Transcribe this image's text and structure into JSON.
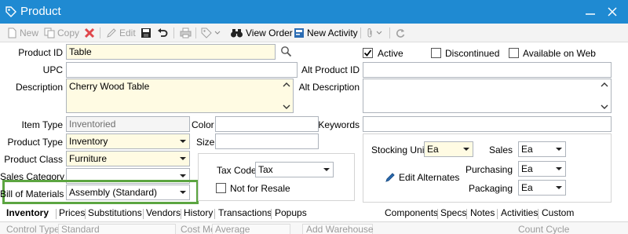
{
  "window": {
    "title": "Product"
  },
  "toolbar": {
    "new": "New",
    "copy": "Copy",
    "edit": "Edit",
    "view_order": "View Order",
    "new_activity": "New Activity"
  },
  "form": {
    "product_id": {
      "label": "Product ID",
      "value": "Table"
    },
    "upc": {
      "label": "UPC",
      "value": ""
    },
    "description": {
      "label": "Description",
      "value": "Cherry Wood Table"
    },
    "active": {
      "label": "Active",
      "checked": true
    },
    "discontinued": {
      "label": "Discontinued",
      "checked": false
    },
    "available_on_web": {
      "label": "Available on Web",
      "checked": false
    },
    "alt_product_id": {
      "label": "Alt Product ID",
      "value": ""
    },
    "alt_description": {
      "label": "Alt Description",
      "value": ""
    },
    "item_type": {
      "label": "Item Type",
      "value": "Inventoried"
    },
    "color": {
      "label": "Color",
      "value": ""
    },
    "keywords": {
      "label": "Keywords",
      "value": ""
    },
    "product_type": {
      "label": "Product Type",
      "value": "Inventory"
    },
    "size": {
      "label": "Size",
      "value": ""
    },
    "product_class": {
      "label": "Product Class",
      "value": "Furniture"
    },
    "sales_category": {
      "label": "Sales Category",
      "value": ""
    },
    "bill_of_materials": {
      "label": "Bill of Materials",
      "value": "Assembly (Standard)"
    },
    "tax_code": {
      "label": "Tax Code",
      "value": "Tax"
    },
    "not_for_resale": {
      "label": "Not for Resale",
      "checked": false
    },
    "stocking_unit": {
      "label": "Stocking Unit",
      "value": "Ea"
    },
    "sales": {
      "label": "Sales",
      "value": "Ea"
    },
    "purchasing": {
      "label": "Purchasing",
      "value": "Ea"
    },
    "packaging": {
      "label": "Packaging",
      "value": "Ea"
    },
    "edit_alternates": "Edit Alternates"
  },
  "tabs_left": [
    "Inventory",
    "Prices",
    "Substitutions",
    "Vendors",
    "History",
    "Transactions",
    "Popups"
  ],
  "tabs_right": [
    "Components",
    "Specs",
    "Notes",
    "Activities",
    "Custom"
  ],
  "bottom": {
    "control_type_label": "Control Type",
    "control_type_value": "Standard",
    "cost_method_label": "Cost Method",
    "cost_method_value": "Average",
    "add_warehouse": "Add Warehouse",
    "count_cycle": "Count Cycle"
  },
  "colors": {
    "titlebar": "#1f8ad2",
    "highlight": "#5ca541",
    "required_field": "#fffbe3"
  }
}
